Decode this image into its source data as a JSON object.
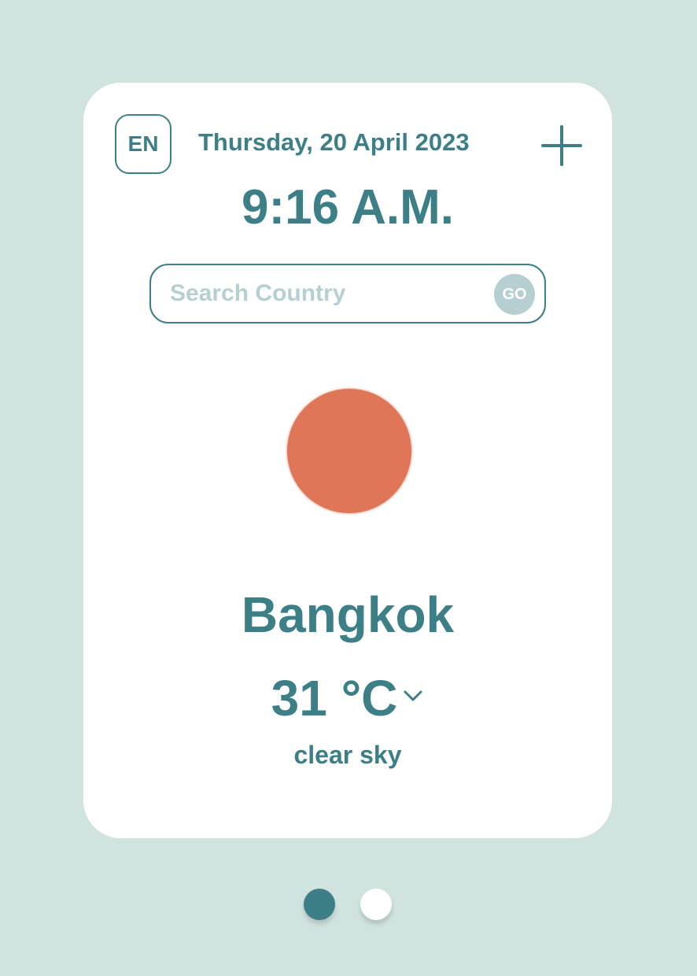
{
  "header": {
    "language": "EN",
    "date": "Thursday, 20 April 2023",
    "time": "9:16 A.M.",
    "add_icon": "plus-icon"
  },
  "search": {
    "placeholder": "Search Country",
    "value": "",
    "go_label": "GO"
  },
  "weather": {
    "icon": "sun-icon",
    "city": "Bangkok",
    "temperature": "31 °C",
    "unit_toggle_icon": "chevron-down-icon",
    "description": "clear sky"
  },
  "pagination": {
    "total": 2,
    "active_index": 0
  },
  "colors": {
    "background": "#d0e3df",
    "card": "#ffffff",
    "primary": "#3d7f86",
    "muted": "#b6d0d1",
    "sun": "#de7657"
  }
}
